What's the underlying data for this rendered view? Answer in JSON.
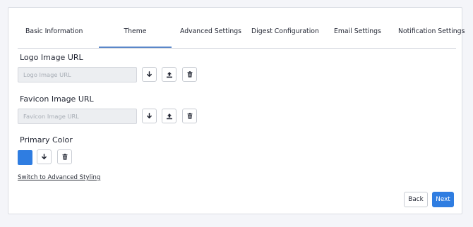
{
  "tabs": [
    {
      "label": "Basic Information",
      "active": false
    },
    {
      "label": "Theme",
      "active": true
    },
    {
      "label": "Advanced Settings",
      "active": false
    },
    {
      "label": "Digest Configuration",
      "active": false
    },
    {
      "label": "Email Settings",
      "active": false
    },
    {
      "label": "Notification Settings",
      "active": false
    }
  ],
  "logo": {
    "label": "Logo Image URL",
    "value": "",
    "placeholder": "Logo Image URL",
    "icons": [
      "download-icon",
      "upload-icon",
      "trash-icon"
    ]
  },
  "favicon": {
    "label": "Favicon Image URL",
    "value": "",
    "placeholder": "Favicon Image URL",
    "icons": [
      "download-icon",
      "upload-icon",
      "trash-icon"
    ]
  },
  "primary_color": {
    "label": "Primary Color",
    "value": "#2f7de1",
    "icons": [
      "download-icon",
      "trash-icon"
    ]
  },
  "switch_link": "Switch to Advanced Styling",
  "buttons": {
    "back": "Back",
    "next": "Next"
  },
  "colors": {
    "accent": "#2f7de1",
    "active_tab_underline": "#5b87c9"
  }
}
